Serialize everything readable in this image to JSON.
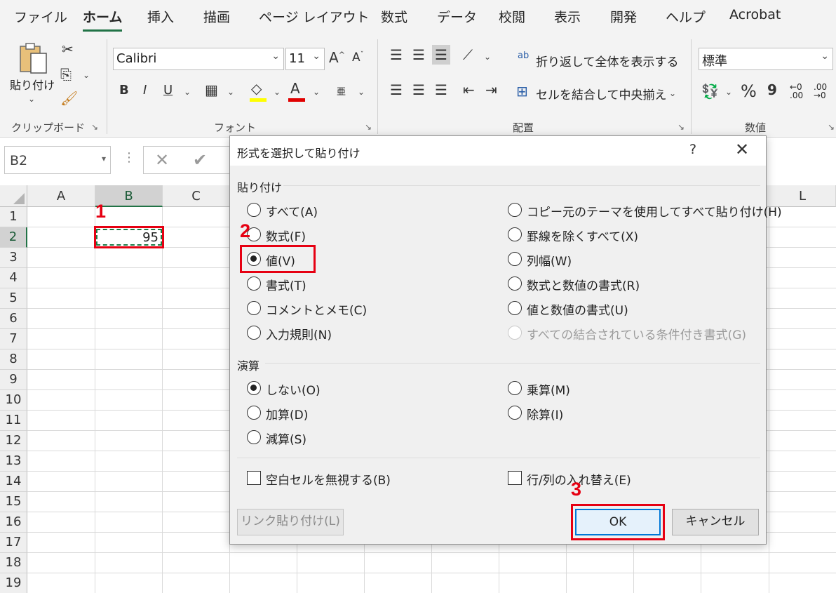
{
  "ribbon": {
    "tabs": [
      "ファイル",
      "ホーム",
      "挿入",
      "描画",
      "ページ レイアウト",
      "数式",
      "データ",
      "校閲",
      "表示",
      "開発",
      "ヘルプ",
      "Acrobat"
    ],
    "active_tab": "ホーム",
    "clipboard": {
      "paste_label": "貼り付け",
      "group_label": "クリップボード"
    },
    "font": {
      "name": "Calibri",
      "size": "11",
      "group_label": "フォント",
      "bold": "B",
      "italic": "I",
      "underline": "U",
      "font_color_glyph": "A",
      "phonetic": "亜"
    },
    "alignment": {
      "wrap_text": "折り返して全体を表示する",
      "merge_center": "セルを結合して中央揃え",
      "group_label": "配置",
      "wrap_glyph": "ab"
    },
    "number": {
      "format": "標準",
      "group_label": "数値",
      "percent": "%",
      "comma": "9",
      "inc_decimal": "←0 .00",
      "dec_decimal": ".00 →0"
    },
    "colors": {
      "accent": "#217346",
      "highlight_yellow": "#ffff00",
      "font_red": "#e00000"
    }
  },
  "formula_bar": {
    "name_box": "B2",
    "cancel_glyph": "✕",
    "enter_glyph": "✔"
  },
  "sheet": {
    "columns": [
      "A",
      "B",
      "C",
      "L"
    ],
    "rows": [
      "1",
      "2",
      "3",
      "4",
      "5",
      "6",
      "7",
      "8",
      "9",
      "10",
      "11",
      "12",
      "13",
      "14",
      "15",
      "16",
      "17",
      "18",
      "19"
    ],
    "selected_cell": {
      "ref": "B2",
      "value": "95"
    }
  },
  "steps": {
    "step1": "1",
    "step2": "2",
    "step3": "3",
    "color": "#e60012"
  },
  "dialog": {
    "title": "形式を選択して貼り付け",
    "help": "?",
    "close": "✕",
    "paste_section": "貼り付け",
    "paste_options_left": [
      {
        "label": "すべて(A)",
        "checked": false
      },
      {
        "label": "数式(F)",
        "checked": false
      },
      {
        "label": "値(V)",
        "checked": true
      },
      {
        "label": "書式(T)",
        "checked": false
      },
      {
        "label": "コメントとメモ(C)",
        "checked": false
      },
      {
        "label": "入力規則(N)",
        "checked": false
      }
    ],
    "paste_options_right": [
      {
        "label": "コピー元のテーマを使用してすべて貼り付け(H)",
        "checked": false
      },
      {
        "label": "罫線を除くすべて(X)",
        "checked": false
      },
      {
        "label": "列幅(W)",
        "checked": false
      },
      {
        "label": "数式と数値の書式(R)",
        "checked": false
      },
      {
        "label": "値と数値の書式(U)",
        "checked": false
      },
      {
        "label": "すべての結合されている条件付き書式(G)",
        "checked": false,
        "disabled": true
      }
    ],
    "operation_section": "演算",
    "operation_left": [
      {
        "label": "しない(O)",
        "checked": true
      },
      {
        "label": "加算(D)",
        "checked": false
      },
      {
        "label": "減算(S)",
        "checked": false
      }
    ],
    "operation_right": [
      {
        "label": "乗算(M)",
        "checked": false
      },
      {
        "label": "除算(I)",
        "checked": false
      }
    ],
    "skip_blanks": "空白セルを無視する(B)",
    "transpose": "行/列の入れ替え(E)",
    "buttons": {
      "paste_link": "リンク貼り付け(L)",
      "ok": "OK",
      "cancel": "キャンセル"
    }
  }
}
